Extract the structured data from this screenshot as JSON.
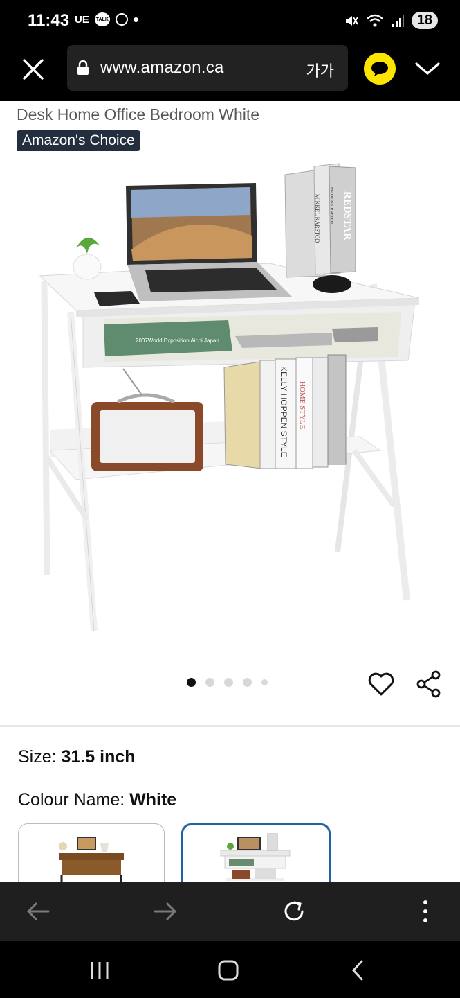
{
  "status_bar": {
    "time": "11:43",
    "carrier": "UE",
    "talk_badge": "TALK",
    "battery": "18"
  },
  "browser": {
    "url": "www.amazon.ca",
    "text_size_label": "가가",
    "icons": [
      "close-icon",
      "lock-icon",
      "kakaotalk-icon",
      "chevron-down-icon"
    ]
  },
  "product": {
    "title_line": "Desk Home Office Bedroom White",
    "badge": "Amazon's Choice",
    "image_texts": {
      "book_1": "MIKKEL KARSTOD",
      "book_2": "MADE & CRAFTED",
      "book_3": "REDSTAR",
      "box_label": "2007World Exposition Aichi Japan",
      "book_kelly": "KELLY HOPPEN STYLE",
      "book_home": "HOME STYLE"
    },
    "carousel": {
      "count": 5,
      "active_index": 0
    }
  },
  "options": {
    "size_label": "Size: ",
    "size_value": "31.5 inch",
    "colour_label": "Colour Name: ",
    "colour_value": "White",
    "selected_swatch_index": 1
  },
  "colors": {
    "badge_bg": "#232f3e",
    "swatch_selected": "#2162a1",
    "kakao_yellow": "#fee500"
  },
  "toolbar": {
    "icons": [
      "back-arrow-icon",
      "forward-arrow-icon",
      "refresh-icon",
      "more-vert-icon"
    ]
  },
  "system_nav": {
    "icons": [
      "recents-icon",
      "home-icon",
      "back-icon"
    ]
  }
}
